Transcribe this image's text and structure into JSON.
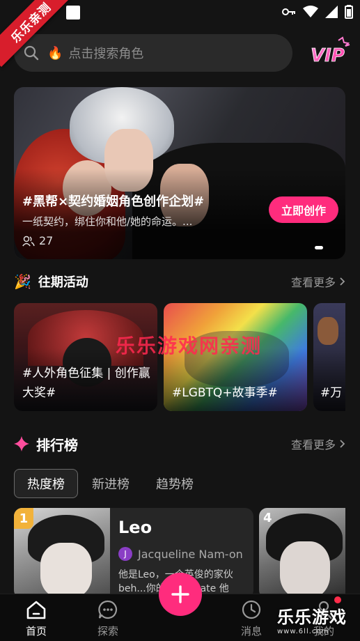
{
  "corner_ribbon": "乐乐亲测",
  "search": {
    "placeholder": "点击搜索角色",
    "flame_icon": "🔥"
  },
  "vip_label": "VIP",
  "banner": {
    "title": "#黑帮×契约婚姻角色创作企划#",
    "subtitle": "一纸契约，绑住你和他/她的命运。...",
    "participants": "27",
    "cta": "立即创作"
  },
  "events_section": {
    "title": "往期活动",
    "more": "查看更多",
    "items": [
      {
        "label": "#人外角色征集 | 创作赢大奖#"
      },
      {
        "label": "#LGBTQ+故事季#"
      },
      {
        "label": "#万"
      }
    ]
  },
  "watermark": "乐乐游戏网亲测",
  "ranking_section": {
    "title": "排行榜",
    "more": "查看更多",
    "tabs": [
      "热度榜",
      "新进榜",
      "趋势榜"
    ],
    "cards": [
      {
        "rank": "1",
        "name": "Leo",
        "author_initial": "J",
        "author": "Jacqueline Nam-on",
        "desc": "他是Leo，一个英俊的家伙 beh...你的roommate 他"
      },
      {
        "rank": "4"
      }
    ]
  },
  "bottom_nav": {
    "items": [
      "首页",
      "探索",
      "消息",
      "我的"
    ],
    "brand": "乐乐游戏",
    "brand_url": "www.6ll.com"
  },
  "colors": {
    "accent_pink": "#ff2c7d",
    "rank_gold": "#f2b23a",
    "background": "#141414"
  }
}
